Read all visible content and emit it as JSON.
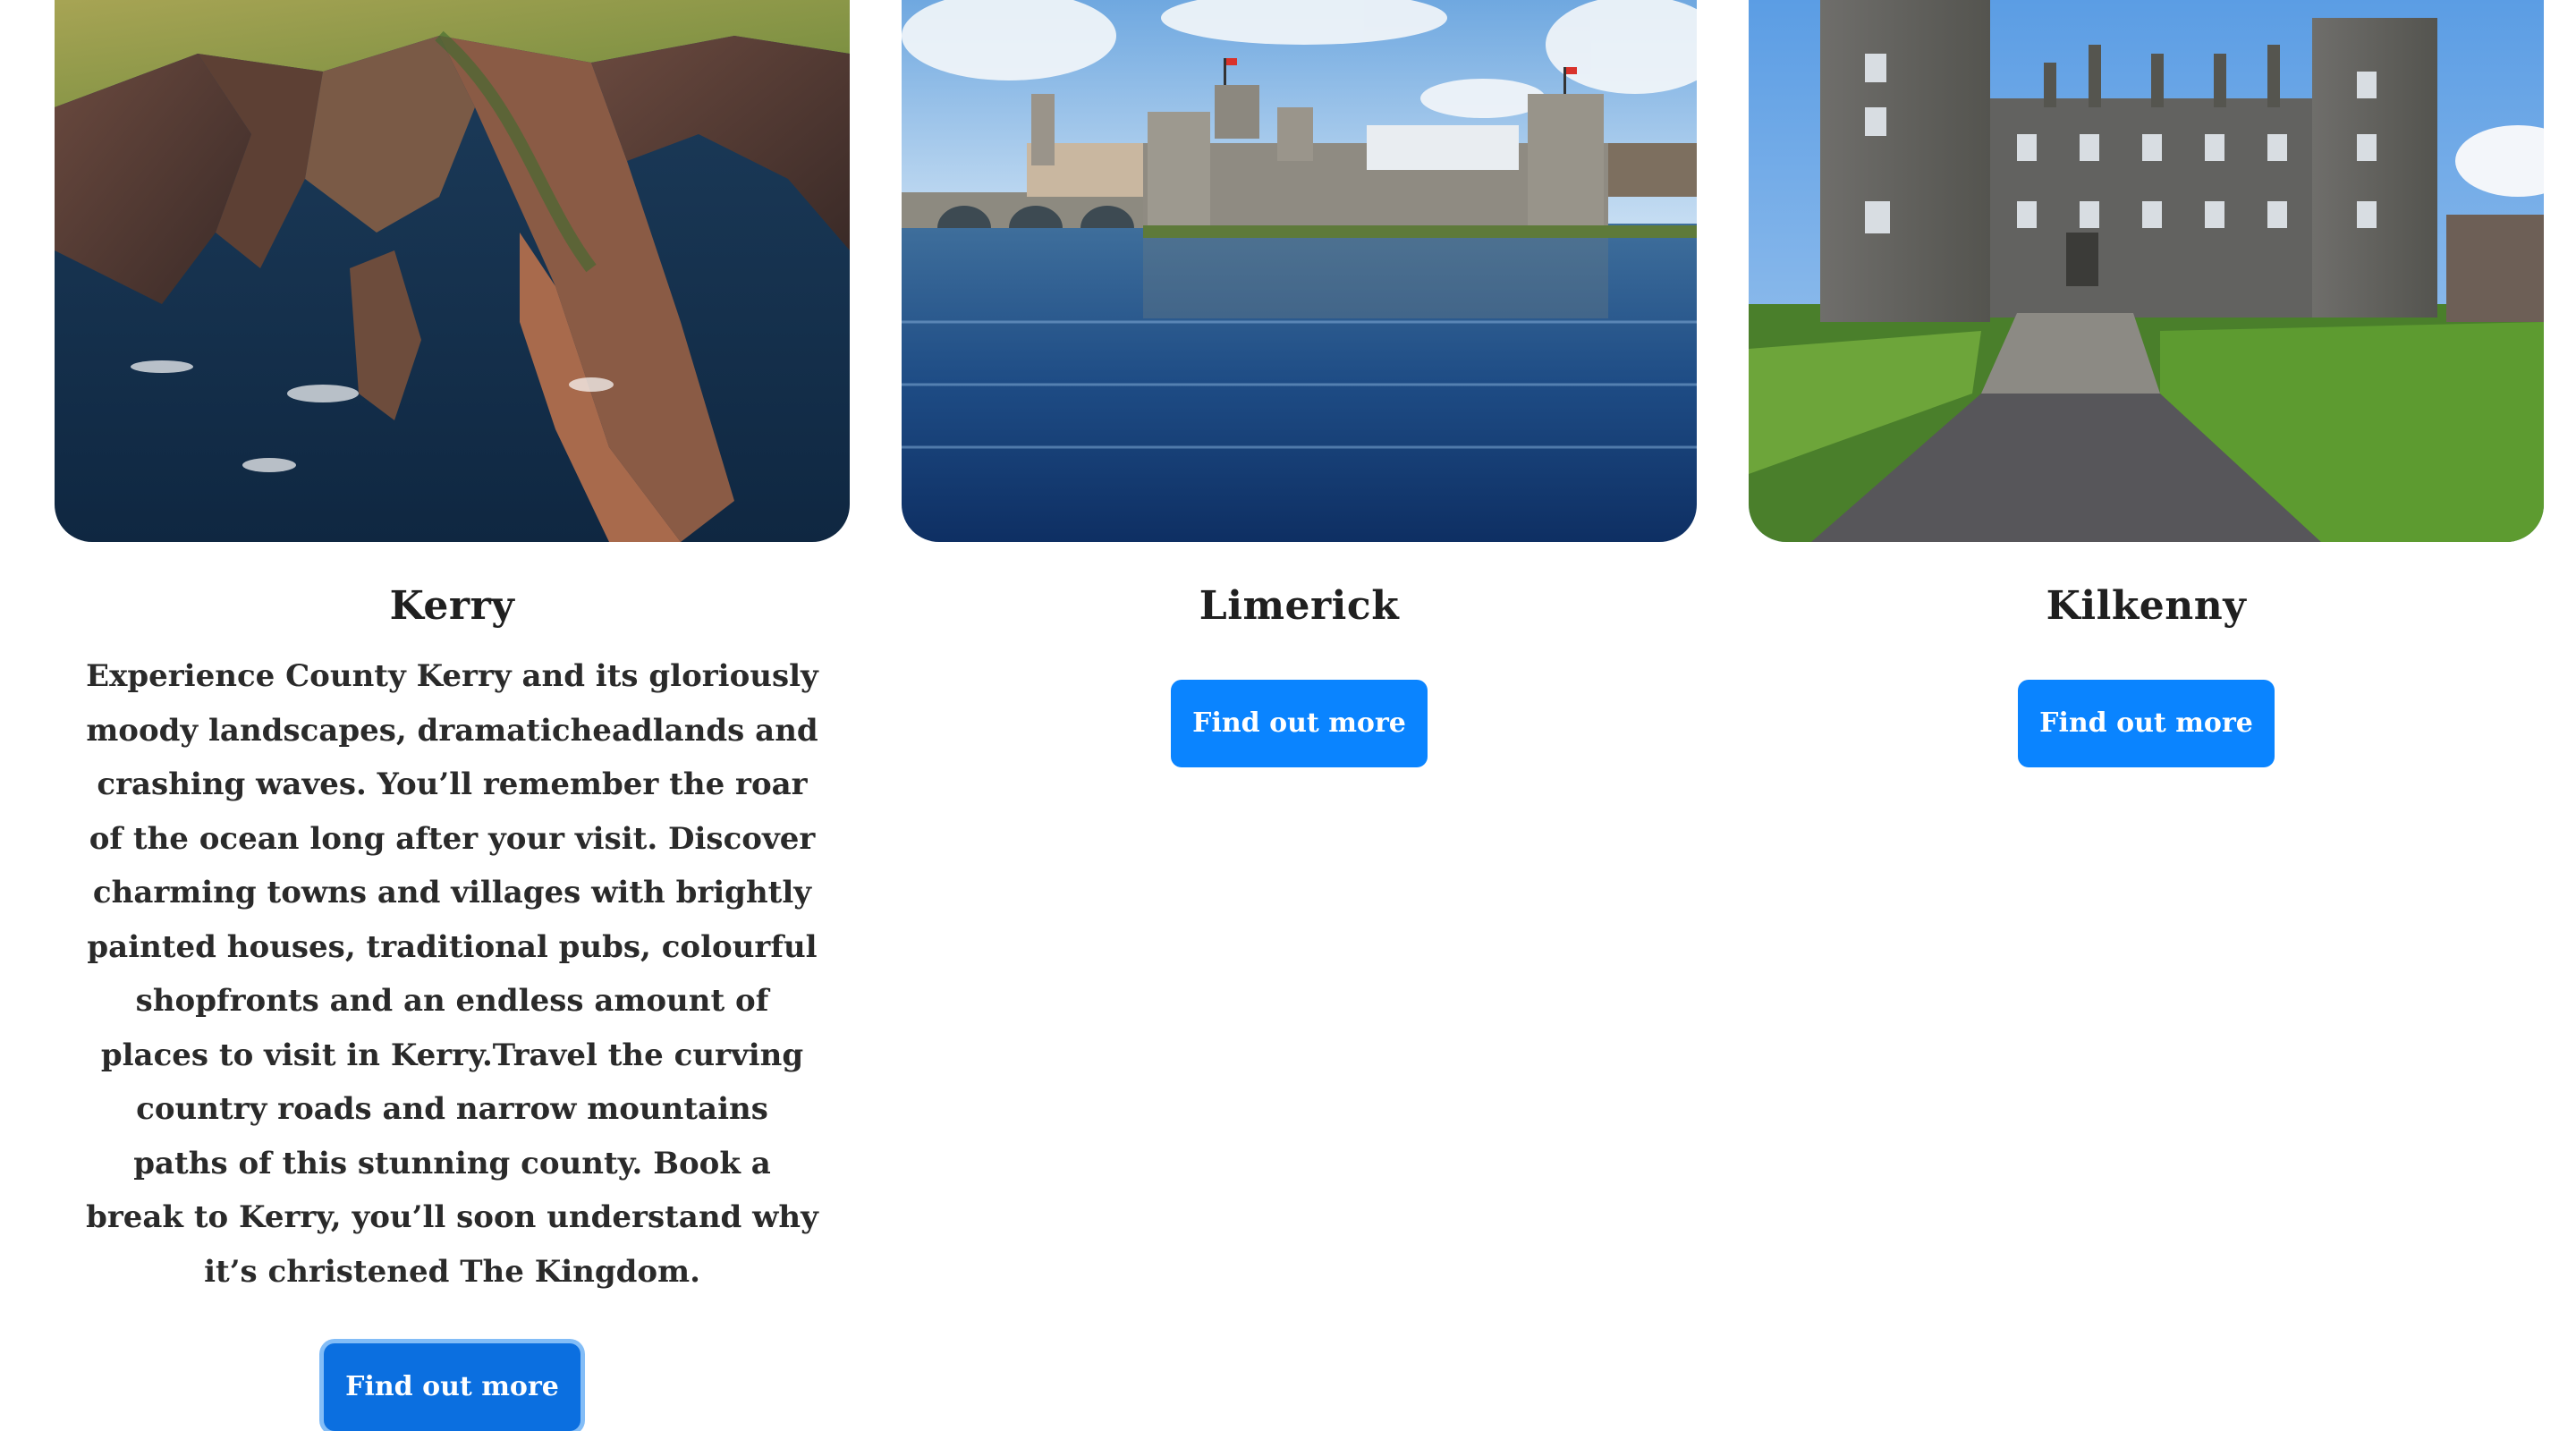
{
  "cards": [
    {
      "image_alt": "Kerry sea cliffs and ocean",
      "title": "Kerry",
      "text": "Experience County Kerry and its gloriously moody landscapes, dramaticheadlands and crashing waves. You’ll remember the roar of the ocean long after your visit. Discover charming towns and villages with brightly painted houses, traditional pubs, colourful shopfronts and an endless amount of places to visit in Kerry.Travel the curving country roads and narrow mountains paths of this stunning county. Book a break to Kerry, you’ll soon understand why it’s christened The Kingdom.",
      "button_label": "Find out more"
    },
    {
      "image_alt": "Limerick castle on the river",
      "title": "Limerick",
      "button_label": "Find out more"
    },
    {
      "image_alt": "Kilkenny castle and lawn",
      "title": "Kilkenny",
      "button_label": "Find out more"
    }
  ],
  "colors": {
    "button": "#0a84ff",
    "button_focused": "#0b6fe0",
    "focus_ring": "#83bdf7",
    "text": "#212529"
  }
}
